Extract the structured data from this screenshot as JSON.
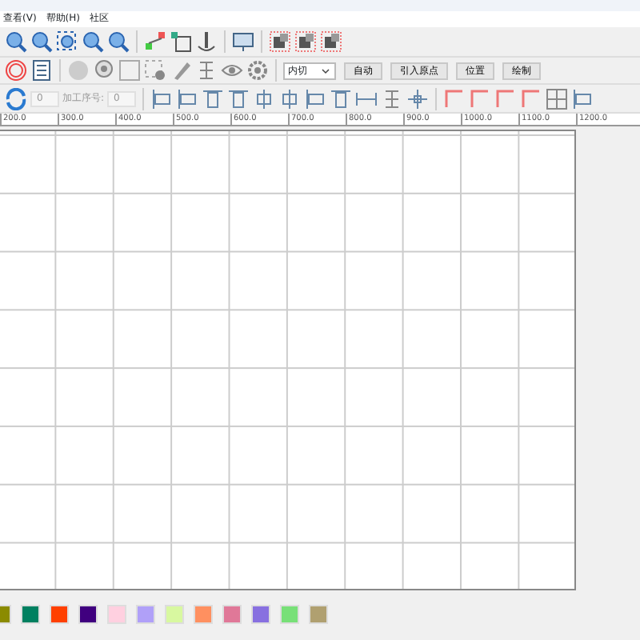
{
  "menu": [
    {
      "label": "查看(V)"
    },
    {
      "label": "帮助(H)"
    },
    {
      "label": "社区"
    }
  ],
  "cut_mode": {
    "value": "内切"
  },
  "actions": [
    "自动",
    "引入原点",
    "位置",
    "绘制"
  ],
  "rotation": {
    "value": "0"
  },
  "process_order": {
    "label": "加工序号:",
    "value": "0"
  },
  "ruler": [
    "200.0",
    "300.0",
    "400.0",
    "500.0",
    "600.0",
    "700.0",
    "800.0",
    "900.0",
    "1000.0",
    "1100.0",
    "1200.0"
  ],
  "palette": [
    {
      "color": "#8b8b00"
    },
    {
      "color": "#008060"
    },
    {
      "color": "#ff4000"
    },
    {
      "color": "#40007f"
    },
    {
      "color": "#ffd0e0"
    },
    {
      "color": "#b0a0f8"
    },
    {
      "color": "#d8f8a0"
    },
    {
      "color": "#ff9060"
    },
    {
      "color": "#e07898"
    },
    {
      "color": "#8870e0"
    },
    {
      "color": "#78e078"
    },
    {
      "color": "#b0a070"
    }
  ]
}
